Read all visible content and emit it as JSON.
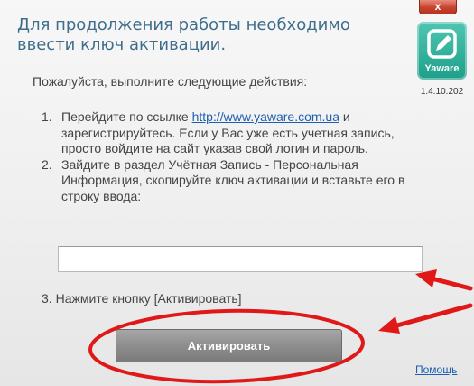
{
  "window": {
    "close_label": "x",
    "title": "Для продолжения работы необходимо ввести ключ активации."
  },
  "logo": {
    "text": "Yaware",
    "icon": "pencil-in-square-icon",
    "color": "#24a58f"
  },
  "version": "1.4.10.202",
  "intro": "Пожалуйста, выполните следующие действия:",
  "steps": [
    {
      "num": "1.",
      "prefix": "Перейдите по ссылке ",
      "link": "http://www.yaware.com.ua",
      "suffix": " и зарегистрируйтесь. Если у Вас уже есть учетная запись, просто войдите на сайт указав свой логин и пароль."
    },
    {
      "num": "2.",
      "text": "Зайдите в раздел Учётная Запись - Персональная Информация, скопируйте ключ активации и вставьте его в строку ввода:"
    },
    {
      "num": "3.",
      "text": "Нажмите кнопку [Активировать]"
    }
  ],
  "key_input": {
    "value": "",
    "placeholder": ""
  },
  "activate_label": "Активировать",
  "help_label": "Помощь",
  "annotation_color": "#e01818"
}
